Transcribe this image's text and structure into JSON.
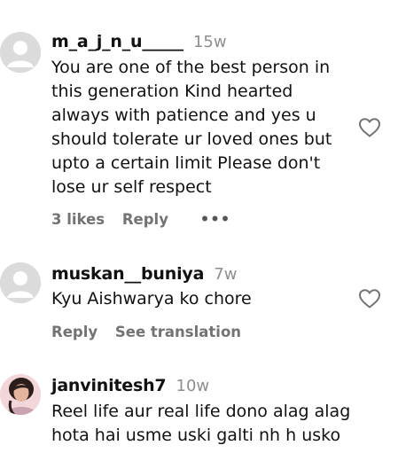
{
  "comments": [
    {
      "username": "m_a_j_n_u_____",
      "time": "15w",
      "text": "You are one of the best person in this generation Kind hearted always with patience and yes u should tolerate ur loved ones but upto a certain limit Please don't lose ur self respect",
      "likes": "3 likes",
      "reply": "Reply",
      "more": "•••",
      "avatar_icon": "default-avatar-icon"
    },
    {
      "username": "muskan__buniya",
      "time": "7w",
      "text": "Kyu Aishwarya ko chore",
      "reply": "Reply",
      "translate": "See translation",
      "avatar_icon": "default-avatar-icon"
    },
    {
      "username": "janvinitesh7",
      "time": "10w",
      "text": "Reel life aur real life dono alag alag hota hai usme uski galti nh h usko",
      "avatar_icon": "profile-photo"
    }
  ],
  "colors": {
    "text": "#111111",
    "muted": "#8e8e8e",
    "action": "#737373",
    "avatar_bg": "#dcdcdc"
  }
}
